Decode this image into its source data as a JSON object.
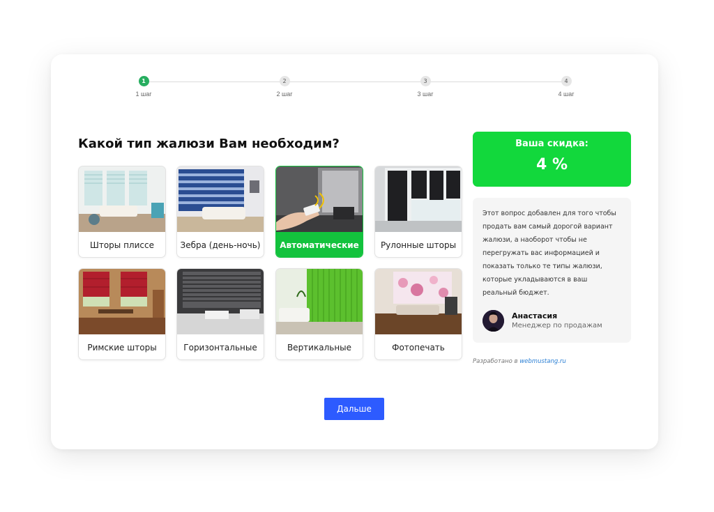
{
  "stepper": {
    "steps": [
      {
        "number": "1",
        "label": "1 шаг",
        "active": true
      },
      {
        "number": "2",
        "label": "2 шаг",
        "active": false
      },
      {
        "number": "3",
        "label": "3 шаг",
        "active": false
      },
      {
        "number": "4",
        "label": "4 шаг",
        "active": false
      }
    ]
  },
  "question": "Какой тип жалюзи Вам необходим?",
  "options": [
    {
      "label": "Шторы плиссе",
      "selected": false
    },
    {
      "label": "Зебра (день-ночь)",
      "selected": false
    },
    {
      "label": "Автоматические",
      "selected": true
    },
    {
      "label": "Рулонные шторы",
      "selected": false
    },
    {
      "label": "Римские шторы",
      "selected": false
    },
    {
      "label": "Горизонтальные",
      "selected": false
    },
    {
      "label": "Вертикальные",
      "selected": false
    },
    {
      "label": "Фотопечать",
      "selected": false
    }
  ],
  "discount": {
    "title": "Ваша скидка:",
    "value": "4 %"
  },
  "info": {
    "text": "Этот вопрос добавлен для того чтобы продать вам самый дорогой вариант жалюзи, а наоборот чтобы не перегружать вас информацией и показать только те типы жалюзи, которые укладываются в ваш реальный бюджет.",
    "manager_name": "Анастасия",
    "manager_role": "Менеджер по продажам"
  },
  "footer": {
    "dev_prefix": "Разработано в",
    "dev_link": "webmustang.ru"
  },
  "next_button": "Дальше",
  "colors": {
    "accent_green": "#13c23d",
    "discount_green": "#12d83c",
    "step_active": "#27ae60",
    "button_blue": "#2d5bff",
    "link_blue": "#2a7fd4"
  }
}
